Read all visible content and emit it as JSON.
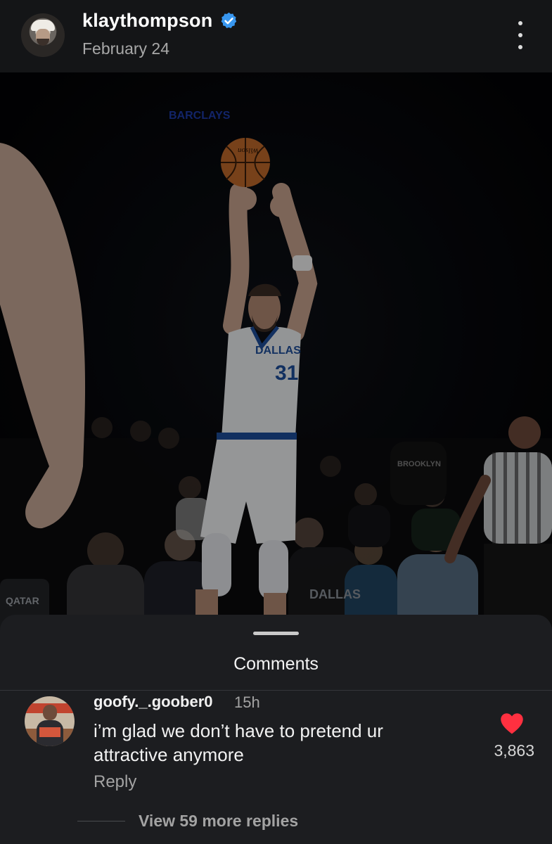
{
  "post": {
    "username": "klaythompson",
    "date": "February 24",
    "verified_icon": "verified-badge-icon",
    "more_icon": "more-vertical-icon"
  },
  "photo": {
    "jersey_team": "DALLAS",
    "jersey_number": "31",
    "ball_brand": "Wilson",
    "arena_sign": "BARCLAYS",
    "courtside_sign": "QATAR",
    "fan_shirt": "DALLAS",
    "crowd_sign": "BROOKLYN"
  },
  "comments_sheet": {
    "title": "Comments",
    "comments": [
      {
        "username": "goofy._.goober0",
        "time": "15h",
        "text": "i’m glad we don’t have to pretend ur attractive anymore",
        "reply_label": "Reply",
        "likes": "3,863",
        "view_replies": "View 59 more replies"
      }
    ]
  },
  "colors": {
    "header_bg": "#141517",
    "sheet_bg": "#1c1d20",
    "verified": "#3897f0",
    "like": "#ff3040",
    "secondary_text": "#a3a3a3"
  }
}
